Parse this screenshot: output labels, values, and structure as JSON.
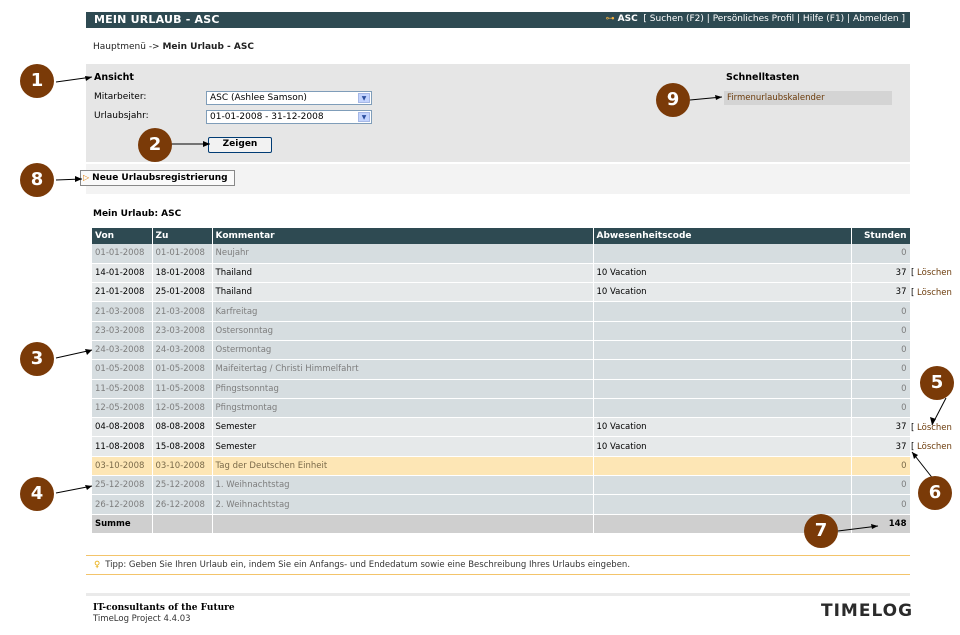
{
  "header": {
    "title": "MEIN URLAUB - ASC",
    "user": "ASC",
    "links": [
      "[ Suchen (F2)",
      "Persönliches Profil",
      "Hilfe (F1)",
      "Abmelden ]"
    ]
  },
  "breadcrumb": {
    "root": "Hauptmenü",
    "separator": " -> ",
    "current": "Mein Urlaub - ASC"
  },
  "filter": {
    "title": "Ansicht",
    "employee_label": "Mitarbeiter:",
    "employee_value": "ASC (Ashlee Samson)",
    "year_label": "Urlaubsjahr:",
    "year_value": "01-01-2008 - 31-12-2008",
    "show_button": "Zeigen"
  },
  "shortcuts": {
    "title": "Schnelltasten",
    "items": [
      "Firmenurlaubskalender"
    ]
  },
  "new_registration_button": "Neue Urlaubsregistrierung",
  "section_title": "Mein Urlaub: ASC",
  "table": {
    "headers": {
      "from": "Von",
      "to": "Zu",
      "comment": "Kommentar",
      "code": "Abwesenheitscode",
      "hours": "Stunden"
    },
    "rows": [
      {
        "from": "01-01-2008",
        "to": "01-01-2008",
        "comment": "Neujahr",
        "code": "",
        "hours": "0",
        "type": "holiday"
      },
      {
        "from": "14-01-2008",
        "to": "18-01-2008",
        "comment": "Thailand",
        "code": "10 Vacation",
        "hours": "37",
        "type": "vacation"
      },
      {
        "from": "21-01-2008",
        "to": "25-01-2008",
        "comment": "Thailand",
        "code": "10 Vacation",
        "hours": "37",
        "type": "vacation"
      },
      {
        "from": "21-03-2008",
        "to": "21-03-2008",
        "comment": "Karfreitag",
        "code": "",
        "hours": "0",
        "type": "holiday"
      },
      {
        "from": "23-03-2008",
        "to": "23-03-2008",
        "comment": "Ostersonntag",
        "code": "",
        "hours": "0",
        "type": "holiday"
      },
      {
        "from": "24-03-2008",
        "to": "24-03-2008",
        "comment": "Ostermontag",
        "code": "",
        "hours": "0",
        "type": "holiday"
      },
      {
        "from": "01-05-2008",
        "to": "01-05-2008",
        "comment": "Maifeitertag / Christi Himmelfahrt",
        "code": "",
        "hours": "0",
        "type": "holiday"
      },
      {
        "from": "11-05-2008",
        "to": "11-05-2008",
        "comment": "Pfingstsonntag",
        "code": "",
        "hours": "0",
        "type": "holiday"
      },
      {
        "from": "12-05-2008",
        "to": "12-05-2008",
        "comment": "Pfingstmontag",
        "code": "",
        "hours": "0",
        "type": "holiday"
      },
      {
        "from": "04-08-2008",
        "to": "08-08-2008",
        "comment": "Semester",
        "code": "10 Vacation",
        "hours": "37",
        "type": "vacation"
      },
      {
        "from": "11-08-2008",
        "to": "15-08-2008",
        "comment": "Semester",
        "code": "10 Vacation",
        "hours": "37",
        "type": "vacation"
      },
      {
        "from": "03-10-2008",
        "to": "03-10-2008",
        "comment": "Tag der Deutschen Einheit",
        "code": "",
        "hours": "0",
        "type": "highlight"
      },
      {
        "from": "25-12-2008",
        "to": "25-12-2008",
        "comment": "1. Weihnachtstag",
        "code": "",
        "hours": "0",
        "type": "holiday"
      },
      {
        "from": "26-12-2008",
        "to": "26-12-2008",
        "comment": "2. Weihnachtstag",
        "code": "",
        "hours": "0",
        "type": "holiday"
      }
    ],
    "sum_label": "Summe",
    "sum_value": "148",
    "delete_label": "Löschen"
  },
  "tip": "Tipp: Geben Sie Ihren Urlaub ein, indem Sie ein Anfangs- und Endedatum sowie eine Beschreibung Ihres Urlaubs eingeben.",
  "footer": {
    "company": "IT-consultants of the Future",
    "version": "TimeLog Project 4.4.03",
    "brand": "TIMELOG"
  },
  "callouts": [
    "1",
    "2",
    "3",
    "4",
    "5",
    "6",
    "7",
    "8",
    "9"
  ],
  "colors": {
    "header_bg": "#2e4a52",
    "callout": "#7a3a08",
    "highlight_row": "#fde6b5",
    "link": "#6b3b0b"
  }
}
